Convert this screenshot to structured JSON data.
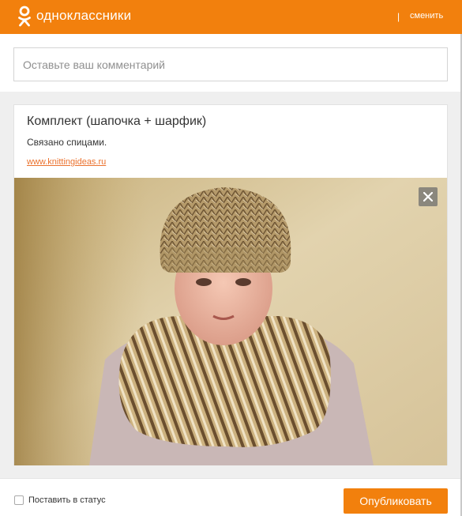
{
  "header": {
    "logo_text": "одноклассники",
    "separator": "|",
    "switch_label": "сменить",
    "logo_icon": "ok-logo-icon",
    "brand_color": "#f2800d"
  },
  "comment": {
    "placeholder": "Оставьте ваш комментарий",
    "value": ""
  },
  "card": {
    "title": "Комплект (шапочка + шарфик)",
    "description": "Связано спицами.",
    "link": "www.knittingideas.ru",
    "close_icon": "close-icon"
  },
  "footer": {
    "status_label": "Поставить в статус",
    "status_checked": false,
    "publish_label": "Опубликовать"
  }
}
